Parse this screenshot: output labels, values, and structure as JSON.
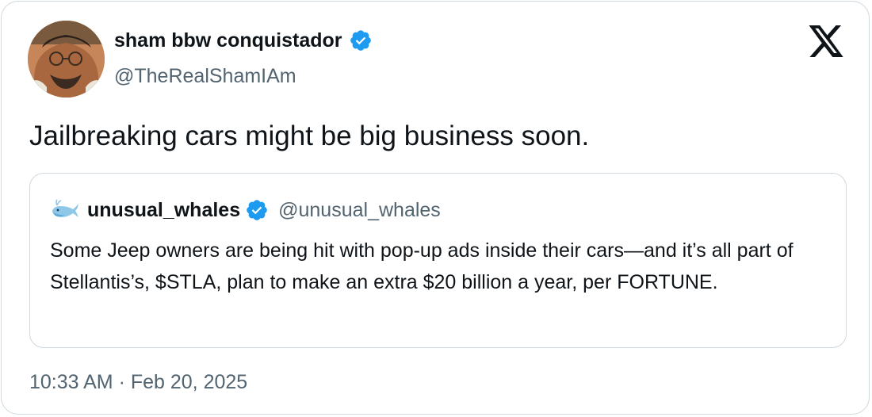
{
  "author": {
    "name": "sham bbw conquistador",
    "handle": "@TheRealShamIAm",
    "verified": true
  },
  "tweet": {
    "text": "Jailbreaking cars might be big business soon.",
    "timestamp": "10:33 AM · Feb 20, 2025"
  },
  "quoted_tweet": {
    "name": "unusual_whales",
    "handle": "@unusual_whales",
    "verified": true,
    "text": "Some Jeep owners are being hit with pop-up ads inside their cars—and it’s all part of Stellantis’s, $STLA, plan to make an extra $20 billion a year, per FORTUNE."
  },
  "icons": {
    "verified": "verified-badge-icon",
    "brand": "x-logo-icon",
    "quoted_avatar": "whale-icon"
  },
  "colors": {
    "verified": "#1d9bf0",
    "text": "#0f1419",
    "secondary_text": "#536471",
    "border": "#cfd9de"
  }
}
